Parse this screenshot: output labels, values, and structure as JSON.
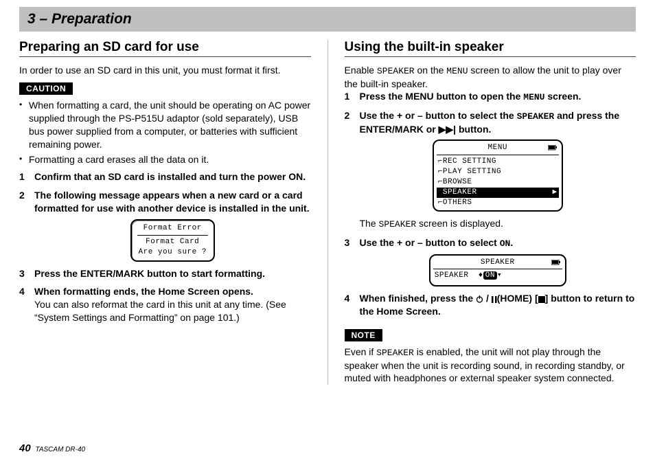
{
  "chapter": "3 – Preparation",
  "footer": {
    "page": "40",
    "model": "TASCAM DR-40"
  },
  "left": {
    "title": "Preparing an SD card for use",
    "intro": "In order to use an SD card in this unit, you must format it first.",
    "caution_label": "CAUTION",
    "cautions": [
      "When formatting a card, the unit should be operating on AC power supplied through the PS-P515U adaptor (sold separately), USB bus power supplied from a computer, or batteries with sufficient remaining power.",
      "Formatting a card erases all the data on it."
    ],
    "steps": {
      "s1": "Confirm that an SD card is installed and turn the power ON.",
      "s2": "The following message appears when a new card or a card formatted for use with another device is installed in the unit.",
      "s3": "Press the ENTER/MARK button to start formatting.",
      "s4": "When formatting ends, the Home Screen opens.",
      "s4_sub": "You can also reformat the card in this unit at any time. (See “System Settings and Formatting” on page 101.)"
    },
    "screen": {
      "l1": "Format Error",
      "l2": "Format Card",
      "l3": "Are you sure ?"
    }
  },
  "right": {
    "title": "Using the built-in speaker",
    "intro_a": "Enable ",
    "intro_b": " on the ",
    "intro_c": " screen to allow the unit to play over the built-in speaker.",
    "lcd_speaker": "SPEAKER",
    "lcd_menu": "MENU",
    "lcd_on": "ON",
    "steps": {
      "s1_a": "Press the MENU button to open the ",
      "s1_b": " screen.",
      "s2_a": "Use the + or – button to select the ",
      "s2_b": " and press the ENTER/MARK or ",
      "s2_c": " button.",
      "s2_after_a": "The ",
      "s2_after_b": " screen is displayed.",
      "s3_a": "Use the + or – button to select ",
      "s3_b": ".",
      "s4_a": "When finished, press the ",
      "s4_b": "(HOME) [",
      "s4_c": "] button to return to the Home Screen."
    },
    "menu": {
      "title": "MENU",
      "rows": [
        "REC SETTING",
        "PLAY SETTING",
        "BROWSE",
        "SPEAKER",
        "OTHERS"
      ],
      "selected": 3
    },
    "speaker_screen": {
      "title": "SPEAKER",
      "label": "SPEAKER",
      "value": "ON"
    },
    "note_label": "NOTE",
    "note_a": "Even if ",
    "note_b": " is enabled, the unit will not play through the speaker when the unit is recording sound, in recording standby, or muted with headphones or external speaker system connected."
  }
}
